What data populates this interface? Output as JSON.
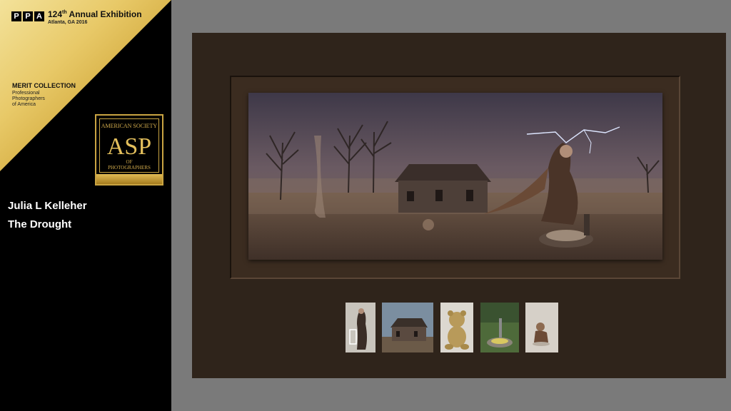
{
  "header": {
    "ppa_letters": [
      "P",
      "P",
      "A"
    ],
    "exhibition_number": "124",
    "exhibition_suffix": "th",
    "exhibition_title": "Annual Exhibition",
    "location": "Atlanta, GA 2016"
  },
  "collection": {
    "label": "MERIT COLLECTION",
    "org_line1": "Professional",
    "org_line2": "Photographers",
    "org_line3": "of America"
  },
  "asp_badge": {
    "top_text": "AMERICAN SOCIETY",
    "main_text": "ASP",
    "of_text": "OF",
    "bottom_text": "PHOTOGRAPHERS"
  },
  "entry": {
    "artist": "Julia L Kelleher",
    "title": "The Drought"
  },
  "colors": {
    "gold": "#d2a93c",
    "board": "#2f241b",
    "background": "#7a7a7a"
  },
  "thumbnails": [
    {
      "name": "woman-with-chair"
    },
    {
      "name": "abandoned-house"
    },
    {
      "name": "teddy-bear"
    },
    {
      "name": "water-pump"
    },
    {
      "name": "child-sitting"
    }
  ]
}
